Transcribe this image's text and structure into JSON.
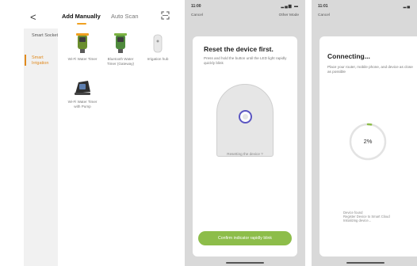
{
  "panel1": {
    "back_glyph": "<",
    "tabs": [
      "Add Manually",
      "Auto Scan"
    ],
    "scan_icon": "scan-icon",
    "sidebar": [
      {
        "label": "Smart Socket"
      },
      {
        "label": "Smart Irrigation"
      }
    ],
    "devices": [
      {
        "label": "Wi-Fi Water Timer",
        "icon": "water-timer-icon"
      },
      {
        "label": "Bluetooth Water Timer (Gateway)",
        "icon": "bluetooth-water-timer-icon"
      },
      {
        "label": "Irrigation hub",
        "icon": "hub-icon"
      },
      {
        "label": "Wi-Fi Water Timer with Pump",
        "icon": "water-timer-pump-icon"
      }
    ],
    "colors": {
      "accent": "#e08a1e",
      "sidebar_bg": "#f1f1f1"
    }
  },
  "panel2": {
    "time": "11:00",
    "cancel": "Cancel",
    "other_mode": "Other Mode",
    "title": "Reset the device first.",
    "description": "Press and hold the button until the LED light rapidly quickly blink",
    "caption": "Resetting the device ?",
    "confirm": "Confirm indicator rapidly blink",
    "colors": {
      "button": "#8dbd4a",
      "ring": "#5b56c2"
    }
  },
  "panel3": {
    "time": "11:01",
    "cancel": "Cancel",
    "title": "Connecting...",
    "description": "Place your router, mobile phone, and device as close as possible",
    "progress_percent": 2,
    "progress_label": "2%",
    "status_lines": [
      "Device found",
      "Register Device to Smart Cloud",
      "Initializing device..."
    ],
    "colors": {
      "progress": "#8dbd4a",
      "track": "#e3e3e3"
    }
  }
}
